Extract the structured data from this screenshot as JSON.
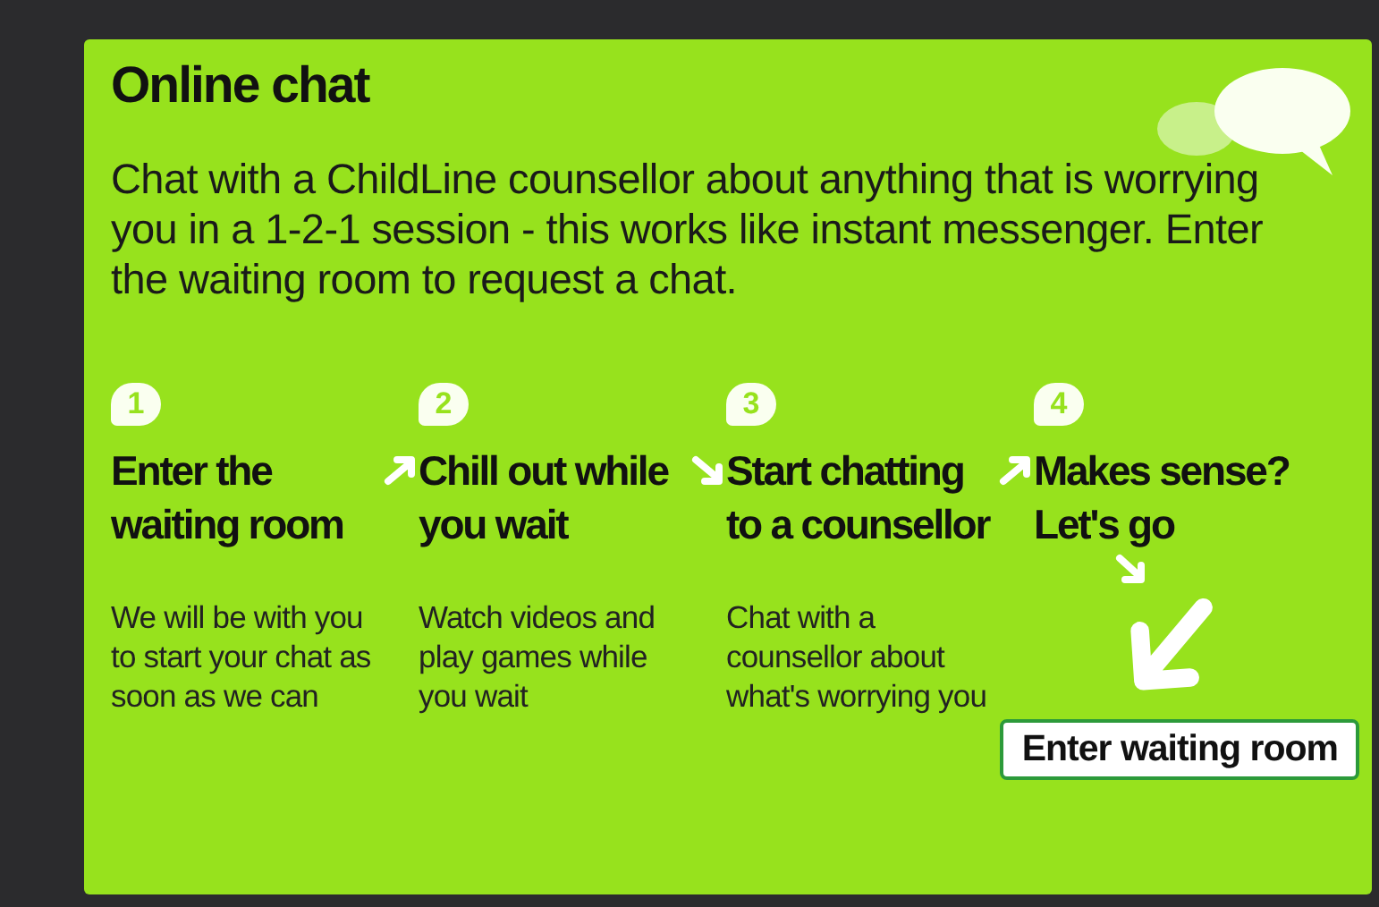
{
  "panel": {
    "title": "Online chat",
    "intro": [
      "Chat with a ChildLine counsellor about anything that is worrying",
      "you in a 1-2-1 session - this works like instant messenger. Enter",
      "the waiting room to request a chat."
    ]
  },
  "steps": [
    {
      "kind": "rising",
      "number": "1",
      "heading": [
        "Enter the",
        "waiting room"
      ],
      "description": [
        "We will be with you",
        "to start your chat as",
        "soon as we can"
      ]
    },
    {
      "kind": "falling",
      "number": "2",
      "heading": [
        "Chill out while",
        "you wait"
      ],
      "description": [
        "Watch videos and",
        "play games while",
        "you wait"
      ]
    },
    {
      "kind": "rising",
      "number": "3",
      "heading": [
        "Start chatting",
        "to a counsellor"
      ],
      "description": [
        "Chat with a",
        "counsellor about",
        "what's worrying you"
      ]
    },
    {
      "kind": "final",
      "number": "4",
      "heading": [
        "Makes sense?",
        "Let's go"
      ]
    }
  ],
  "button": {
    "label": "Enter waiting room"
  }
}
